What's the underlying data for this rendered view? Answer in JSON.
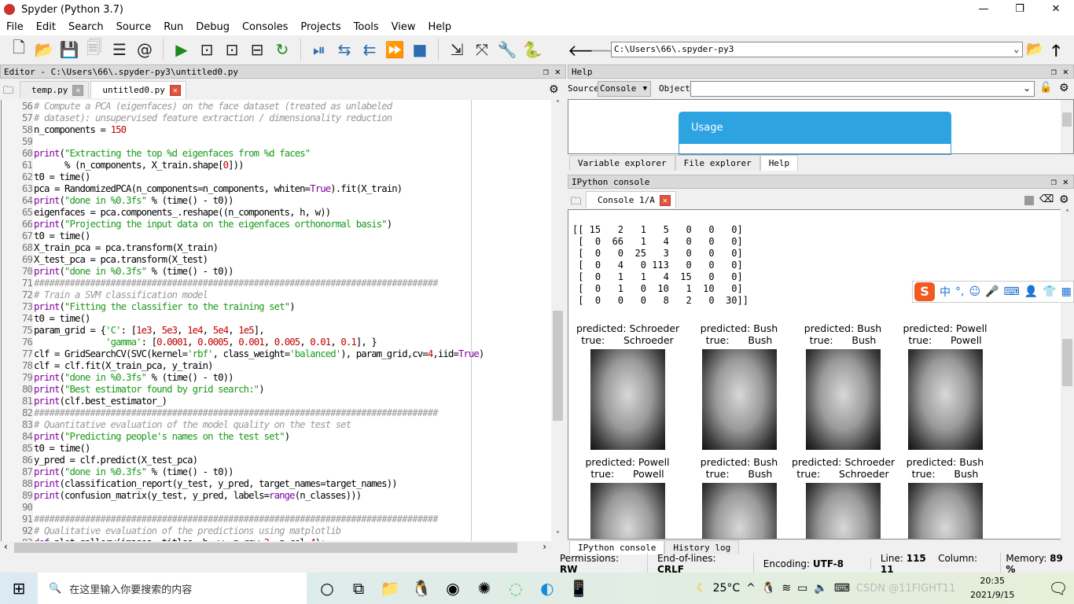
{
  "window": {
    "title": "Spyder (Python 3.7)",
    "controls": [
      "—",
      "❐",
      "✕"
    ]
  },
  "menu": [
    "File",
    "Edit",
    "Search",
    "Source",
    "Run",
    "Debug",
    "Consoles",
    "Projects",
    "Tools",
    "View",
    "Help"
  ],
  "toolbar_icons": [
    "new-file",
    "open-file",
    "save",
    "save-all",
    "outline",
    "at",
    "run",
    "run-cell",
    "run-cell-advance",
    "run-selection",
    "re-run",
    "debug-step",
    "step-into",
    "step-return",
    "continue",
    "stop",
    "maximize-pane",
    "fullscreen",
    "preferences",
    "python-path"
  ],
  "path_bar": {
    "value": "C:\\Users\\66\\.spyder-py3"
  },
  "editor": {
    "header": "Editor - C:\\Users\\66\\.spyder-py3\\untitled0.py",
    "tabs": [
      {
        "label": "temp.py",
        "active": false
      },
      {
        "label": "untitled0.py",
        "active": true
      }
    ],
    "lines": [
      [
        56,
        [
          [
            "c",
            "# Compute a PCA (eigenfaces) on the face dataset (treated as unlabeled"
          ]
        ]
      ],
      [
        57,
        [
          [
            "c",
            "# dataset): unsupervised feature extraction / dimensionality reduction"
          ]
        ]
      ],
      [
        58,
        [
          [
            "p",
            "n_components = "
          ],
          [
            "n",
            "150"
          ]
        ]
      ],
      [
        59,
        []
      ],
      [
        60,
        [
          [
            "k",
            "print"
          ],
          [
            "p",
            "("
          ],
          [
            "s",
            "\"Extracting the top %d eigenfaces from %d faces\""
          ]
        ]
      ],
      [
        61,
        [
          [
            "p",
            "      % (n_components, X_train.shape["
          ],
          [
            "n",
            "0"
          ],
          [
            "p",
            "]))"
          ]
        ]
      ],
      [
        62,
        [
          [
            "p",
            "t0 = time()"
          ]
        ]
      ],
      [
        63,
        [
          [
            "p",
            "pca = RandomizedPCA(n_components=n_components, whiten="
          ],
          [
            "k",
            "True"
          ],
          [
            "p",
            ").fit(X_train)"
          ]
        ]
      ],
      [
        64,
        [
          [
            "k",
            "print"
          ],
          [
            "p",
            "("
          ],
          [
            "s",
            "\"done in %0.3fs\""
          ],
          [
            "p",
            " % (time() - t0))"
          ]
        ]
      ],
      [
        65,
        [
          [
            "p",
            "eigenfaces = pca.components_.reshape((n_components, h, w))"
          ]
        ]
      ],
      [
        66,
        [
          [
            "k",
            "print"
          ],
          [
            "p",
            "("
          ],
          [
            "s",
            "\"Projecting the input data on the eigenfaces orthonormal basis\""
          ],
          [
            "p",
            ")"
          ]
        ]
      ],
      [
        67,
        [
          [
            "p",
            "t0 = time()"
          ]
        ]
      ],
      [
        68,
        [
          [
            "p",
            "X_train_pca = pca.transform(X_train)"
          ]
        ]
      ],
      [
        69,
        [
          [
            "p",
            "X_test_pca = pca.transform(X_test)"
          ]
        ]
      ],
      [
        70,
        [
          [
            "k",
            "print"
          ],
          [
            "p",
            "("
          ],
          [
            "s",
            "\"done in %0.3fs\""
          ],
          [
            "p",
            " % (time() - t0))"
          ]
        ]
      ],
      [
        71,
        [
          [
            "c",
            "###############################################################################"
          ]
        ]
      ],
      [
        72,
        [
          [
            "c",
            "# Train a SVM classification model"
          ]
        ]
      ],
      [
        73,
        [
          [
            "k",
            "print"
          ],
          [
            "p",
            "("
          ],
          [
            "s",
            "\"Fitting the classifier to the training set\""
          ],
          [
            "p",
            ")"
          ]
        ]
      ],
      [
        74,
        [
          [
            "p",
            "t0 = time()"
          ]
        ]
      ],
      [
        75,
        [
          [
            "p",
            "param_grid = {"
          ],
          [
            "s",
            "'C'"
          ],
          [
            "p",
            ": ["
          ],
          [
            "n",
            "1e3"
          ],
          [
            "p",
            ", "
          ],
          [
            "n",
            "5e3"
          ],
          [
            "p",
            ", "
          ],
          [
            "n",
            "1e4"
          ],
          [
            "p",
            ", "
          ],
          [
            "n",
            "5e4"
          ],
          [
            "p",
            ", "
          ],
          [
            "n",
            "1e5"
          ],
          [
            "p",
            "],"
          ]
        ]
      ],
      [
        76,
        [
          [
            "p",
            "              "
          ],
          [
            "s",
            "'gamma'"
          ],
          [
            "p",
            ": ["
          ],
          [
            "n",
            "0.0001"
          ],
          [
            "p",
            ", "
          ],
          [
            "n",
            "0.0005"
          ],
          [
            "p",
            ", "
          ],
          [
            "n",
            "0.001"
          ],
          [
            "p",
            ", "
          ],
          [
            "n",
            "0.005"
          ],
          [
            "p",
            ", "
          ],
          [
            "n",
            "0.01"
          ],
          [
            "p",
            ", "
          ],
          [
            "n",
            "0.1"
          ],
          [
            "p",
            "], }"
          ]
        ]
      ],
      [
        77,
        [
          [
            "p",
            "clf = GridSearchCV(SVC(kernel="
          ],
          [
            "s",
            "'rbf'"
          ],
          [
            "p",
            ", class_weight="
          ],
          [
            "s",
            "'balanced'"
          ],
          [
            "p",
            "), param_grid,cv="
          ],
          [
            "n",
            "4"
          ],
          [
            "p",
            ",iid="
          ],
          [
            "k",
            "True"
          ],
          [
            "p",
            ")"
          ]
        ]
      ],
      [
        78,
        [
          [
            "p",
            "clf = clf.fit(X_train_pca, y_train)"
          ]
        ]
      ],
      [
        79,
        [
          [
            "k",
            "print"
          ],
          [
            "p",
            "("
          ],
          [
            "s",
            "\"done in %0.3fs\""
          ],
          [
            "p",
            " % (time() - t0))"
          ]
        ]
      ],
      [
        80,
        [
          [
            "k",
            "print"
          ],
          [
            "p",
            "("
          ],
          [
            "s",
            "\"Best estimator found by grid search:\""
          ],
          [
            "p",
            ")"
          ]
        ]
      ],
      [
        81,
        [
          [
            "k",
            "print"
          ],
          [
            "p",
            "(clf.best_estimator_)"
          ]
        ]
      ],
      [
        82,
        [
          [
            "c",
            "###############################################################################"
          ]
        ]
      ],
      [
        83,
        [
          [
            "c",
            "# Quantitative evaluation of the model quality on the test set"
          ]
        ]
      ],
      [
        84,
        [
          [
            "k",
            "print"
          ],
          [
            "p",
            "("
          ],
          [
            "s",
            "\"Predicting people's names on the test set\""
          ],
          [
            "p",
            ")"
          ]
        ]
      ],
      [
        85,
        [
          [
            "p",
            "t0 = time()"
          ]
        ]
      ],
      [
        86,
        [
          [
            "p",
            "y_pred = clf.predict(X_test_pca)"
          ]
        ]
      ],
      [
        87,
        [
          [
            "k",
            "print"
          ],
          [
            "p",
            "("
          ],
          [
            "s",
            "\"done in %0.3fs\""
          ],
          [
            "p",
            " % (time() - t0))"
          ]
        ]
      ],
      [
        88,
        [
          [
            "k",
            "print"
          ],
          [
            "p",
            "(classification_report(y_test, y_pred, target_names=target_names))"
          ]
        ]
      ],
      [
        89,
        [
          [
            "k",
            "print"
          ],
          [
            "p",
            "(confusion_matrix(y_test, y_pred, labels="
          ],
          [
            "k",
            "range"
          ],
          [
            "p",
            "(n_classes)))"
          ]
        ]
      ],
      [
        90,
        []
      ],
      [
        91,
        [
          [
            "c",
            "###############################################################################"
          ]
        ]
      ],
      [
        92,
        [
          [
            "c",
            "# Qualitative evaluation of the predictions using matplotlib"
          ]
        ]
      ],
      [
        93,
        [
          [
            "k",
            "def"
          ],
          [
            "p",
            " plot_gallery(images, titles, h, w, n_row="
          ],
          [
            "n",
            "3"
          ],
          [
            "p",
            ", n_col="
          ],
          [
            "n",
            "4"
          ],
          [
            "p",
            "):"
          ]
        ]
      ]
    ]
  },
  "help": {
    "header": "Help",
    "source_label": "Source",
    "source_value": "Console",
    "object_label": "Object",
    "object_value": "",
    "usage_title": "Usage",
    "tabs": [
      "Variable explorer",
      "File explorer",
      "Help"
    ],
    "active_tab": "Help"
  },
  "console": {
    "header": "IPython console",
    "tab": "Console 1/A",
    "matrix": [
      "[[ 15   2   1   5   0   0   0]",
      " [  0  66   1   4   0   0   0]",
      " [  0   0  25   3   0   0   0]",
      " [  0   4   0 113   0   0   0]",
      " [  0   1   1   4  15   0   0]",
      " [  0   1   0  10   1  10   0]",
      " [  0   0   0   8   2   0  30]]"
    ],
    "gallery": [
      {
        "predicted": "predicted: Schroeder",
        "true": "true:      Schroeder"
      },
      {
        "predicted": "predicted: Bush",
        "true": "true:      Bush"
      },
      {
        "predicted": "predicted: Bush",
        "true": "true:      Bush"
      },
      {
        "predicted": "predicted: Powell",
        "true": "true:      Powell"
      },
      {
        "predicted": "predicted: Powell",
        "true": "true:      Powell"
      },
      {
        "predicted": "predicted: Bush",
        "true": "true:      Bush"
      },
      {
        "predicted": "predicted: Schroeder",
        "true": "true:      Schroeder"
      },
      {
        "predicted": "predicted: Bush",
        "true": "true:      Bush"
      }
    ],
    "bottom_tabs": [
      "IPython console",
      "History log"
    ],
    "active_bottom": "IPython console"
  },
  "ime": {
    "items": [
      "中",
      "°,",
      "☺",
      "🎤",
      "⌨",
      "👤",
      "👕",
      "▦"
    ]
  },
  "status": {
    "permissions_label": "Permissions:",
    "permissions": "RW",
    "eol_label": "End-of-lines:",
    "eol": "CRLF",
    "encoding_label": "Encoding:",
    "encoding": "UTF-8",
    "line_label": "Line:",
    "line": "115",
    "column_label": "Column:",
    "column": "11",
    "memory_label": "Memory:",
    "memory": "89 %"
  },
  "taskbar": {
    "search_placeholder": "在这里输入你要搜索的内容",
    "weather": "25°C",
    "time": "20:35",
    "date": "2021/9/15",
    "watermark": "CSDN @11FIGHT11"
  }
}
